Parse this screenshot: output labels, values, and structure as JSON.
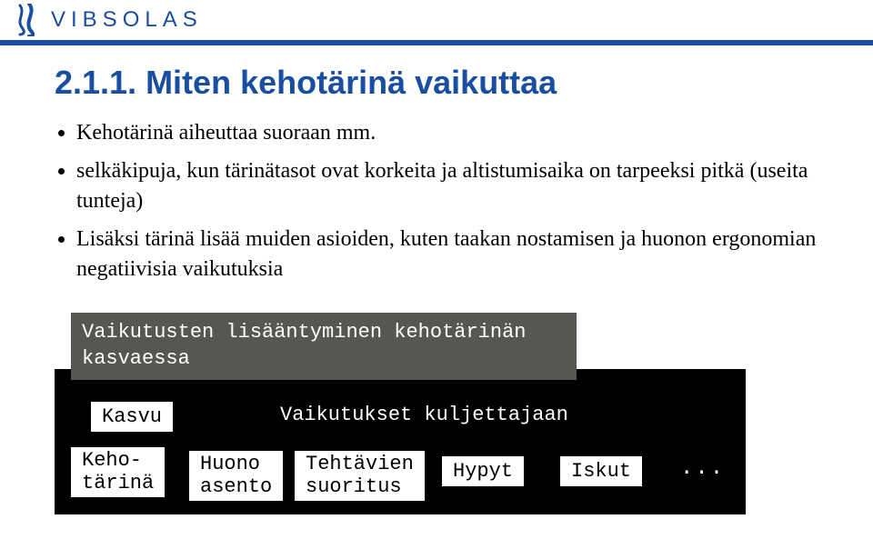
{
  "logo_text": "VIBSOLAS",
  "title": "2.1.1. Miten kehotärinä vaikuttaa",
  "bullets": [
    "Kehotärinä aiheuttaa suoraan mm.",
    "selkäkipuja, kun tärinätasot ovat korkeita ja altistumisaika on tarpeeksi pitkä (useita tunteja)",
    "Lisäksi tärinä lisää muiden asioiden, kuten taakan nostamisen ja huonon ergonomian negatiivisia vaikutuksia"
  ],
  "diagram": {
    "banner": "Vaikutusten lisääntyminen kehotärinän kasvaessa",
    "kasvu": "Kasvu",
    "driver_label": "Vaikutukset kuljettajaan",
    "kehotarina": "Keho-\ntärinä",
    "asento": "Huono\nasento",
    "tehtavien": "Tehtävien\nsuoritus",
    "hypyt": "Hypyt",
    "iskut": "Iskut",
    "dots": "..."
  }
}
